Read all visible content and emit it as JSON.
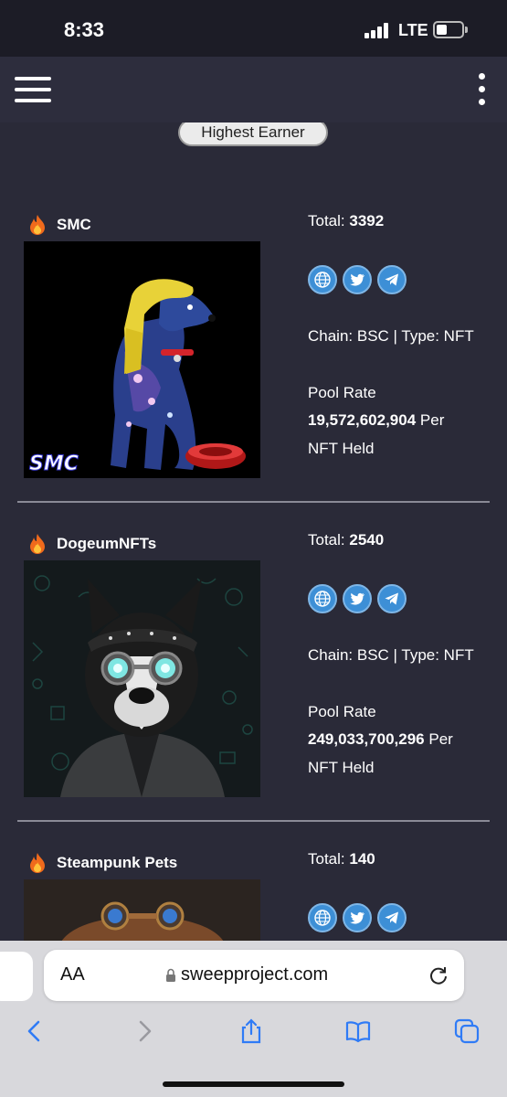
{
  "status_bar": {
    "time": "8:33",
    "network": "LTE"
  },
  "header": {
    "menu_icon": "hamburger-icon",
    "more_icon": "kebab-icon"
  },
  "section_label": "Highest Earner",
  "cards": [
    {
      "name": "SMC",
      "total_label": "Total:",
      "total": "3392",
      "chain_type": "Chain: BSC | Type: NFT",
      "pool_label": "Pool Rate",
      "pool_rate": "19,572,602,904",
      "pool_suffix_a": "Per",
      "pool_suffix_b": "NFT Held",
      "image_caption": "SMC"
    },
    {
      "name": "DogeumNFTs",
      "total_label": "Total:",
      "total": "2540",
      "chain_type": "Chain: BSC | Type: NFT",
      "pool_label": "Pool Rate",
      "pool_rate": "249,033,700,296",
      "pool_suffix_a": "Per",
      "pool_suffix_b": "NFT Held"
    },
    {
      "name": "Steampunk Pets",
      "total_label": "Total:",
      "total": "140"
    }
  ],
  "browser": {
    "aa_label": "AA",
    "url": "sweepproject.com"
  },
  "colors": {
    "background": "#2a2a38",
    "social_blue": "#3d8fd6",
    "divider": "#8a8a96"
  }
}
